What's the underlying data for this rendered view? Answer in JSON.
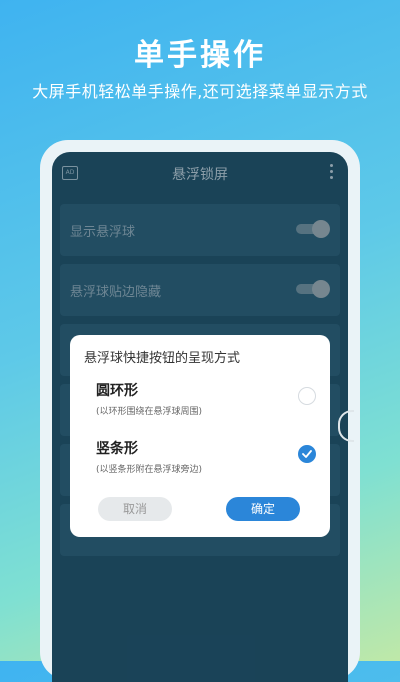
{
  "hero": {
    "title": "单手操作",
    "subtitle": "大屏手机轻松单手操作,还可选择菜单显示方式"
  },
  "app": {
    "title": "悬浮锁屏",
    "header_left_icon": "ad-icon",
    "header_right_icon": "more-vertical-icon"
  },
  "settings": [
    {
      "label": "显示悬浮球",
      "enabled": true
    },
    {
      "label": "悬浮球贴边隐藏",
      "enabled": true
    }
  ],
  "dialog": {
    "title": "悬浮球快捷按钮的呈现方式",
    "options": [
      {
        "title": "圆环形",
        "desc": "(以环形围绕在悬浮球周围)",
        "selected": false
      },
      {
        "title": "竖条形",
        "desc": "(以竖条形附在悬浮球旁边)",
        "selected": true
      }
    ],
    "cancel_label": "取消",
    "ok_label": "确定"
  },
  "colors": {
    "accent": "#2b86d9",
    "screen_bg": "#1f4f66"
  }
}
